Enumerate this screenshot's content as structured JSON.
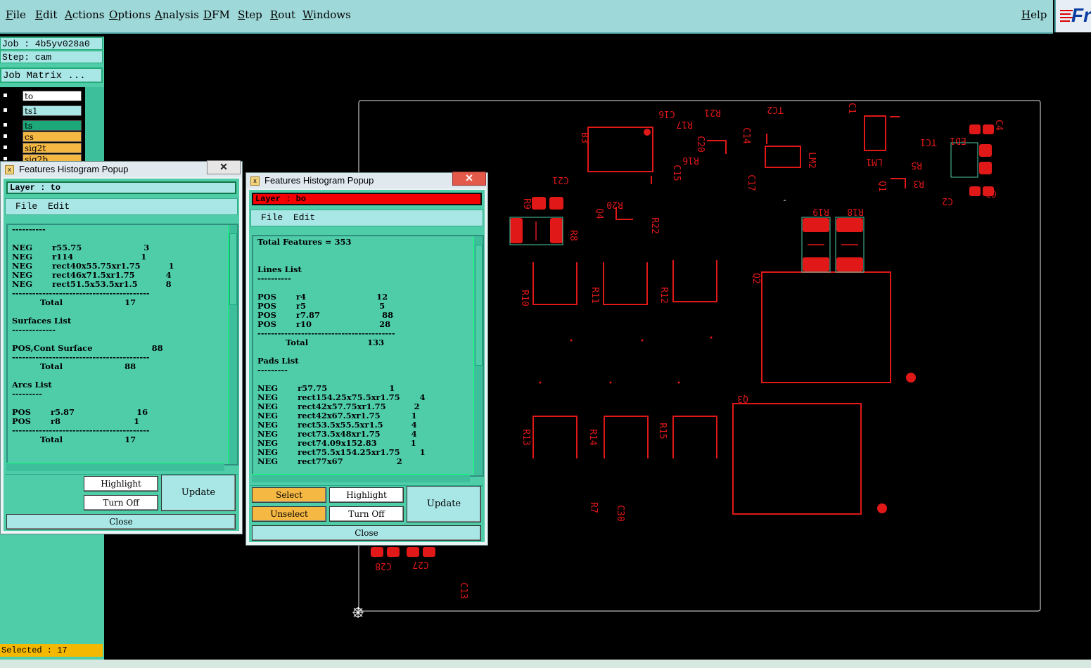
{
  "menu": [
    "File",
    "Edit",
    "Actions",
    "Options",
    "Analysis",
    "DFM",
    "Step",
    "Rout",
    "Windows"
  ],
  "help": "Help",
  "logo_text": "Fr",
  "left_panel": {
    "job": "Job : 4b5yv028a0",
    "step": "Step: cam",
    "job_matrix": "Job Matrix ...",
    "layers": [
      {
        "name": "to",
        "color": "#ffffff"
      },
      {
        "name": "ts1",
        "color": "#a9e6e6"
      },
      {
        "name": "ts",
        "color": "#1da87a"
      },
      {
        "name": "cs",
        "color": "#f5b843"
      },
      {
        "name": "sig2t",
        "color": "#f5b843"
      },
      {
        "name": "sig2b",
        "color": "#f5b843"
      }
    ],
    "selected": "Selected : 17"
  },
  "popup1": {
    "title": "Features Histogram Popup",
    "layer": "Layer :  to",
    "menu": [
      "File",
      "Edit"
    ],
    "list": "----------\n\nNEG       r55.75                      3\nNEG       r114                        1\nNEG       rect40x55.75xr1.75          1\nNEG       rect46x71.5xr1.75           4\nNEG       rect51.5x53.5xr1.5          8\n-----------------------------------------\n          Total                      17\n\nSurfaces List\n-------------\n\nPOS,Cont Surface                     88\n-----------------------------------------\n          Total                      88\n\nArcs List\n---------\n\nPOS       r5.87                      16\nPOS       r8                          1\n-----------------------------------------\n          Total                      17",
    "buttons": {
      "highlight": "Highlight",
      "turn_off": "Turn Off",
      "update": "Update",
      "close": "Close"
    }
  },
  "popup2": {
    "title": "Features Histogram Popup",
    "layer": "Layer :  bo",
    "menu": [
      "File",
      "Edit"
    ],
    "list": "Total Features = 353\n\n\nLines List\n----------\n\nPOS       r4                         12\nPOS       r5                          5\nPOS       r7.87                      88\nPOS       r10                        28\n-----------------------------------------\n          Total                     133\n\nPads List\n---------\n\nNEG       r57.75                      1\nNEG       rect154.25x75.5xr1.75       4\nNEG       rect42x57.75xr1.75          2\nNEG       rect42x67.5xr1.75           1\nNEG       rect53.5x55.5xr1.5          4\nNEG       rect73.5x48xr1.75           4\nNEG       rect74.09x152.83            1\nNEG       rect75.5x154.25xr1.75       1\nNEG       rect77x67                   2",
    "buttons": {
      "select": "Select",
      "unselect": "Unselect",
      "highlight": "Highlight",
      "turn_off": "Turn Off",
      "update": "Update",
      "close": "Close"
    }
  },
  "board_labels": [
    "C16",
    "R21",
    "TC2",
    "C1",
    "R17",
    "C14",
    "B3",
    "C20",
    "R16",
    "LM2",
    "LM1",
    "TC1",
    "ED1",
    "C4",
    "C21",
    "C15",
    "C17",
    "R5",
    "R3",
    "Q1",
    "C2",
    "C3",
    "R9",
    "R20",
    "Q4",
    "R22",
    "R8",
    "R19",
    "R18",
    "Q2",
    "R10",
    "R11",
    "R12",
    "Q3",
    "R13",
    "R14",
    "R15",
    "R7",
    "C30",
    "C28",
    "C27",
    "C13"
  ],
  "colors": {
    "trace": "#e01818",
    "menubar": "#9fd8d8",
    "panel": "#4fcca8"
  }
}
